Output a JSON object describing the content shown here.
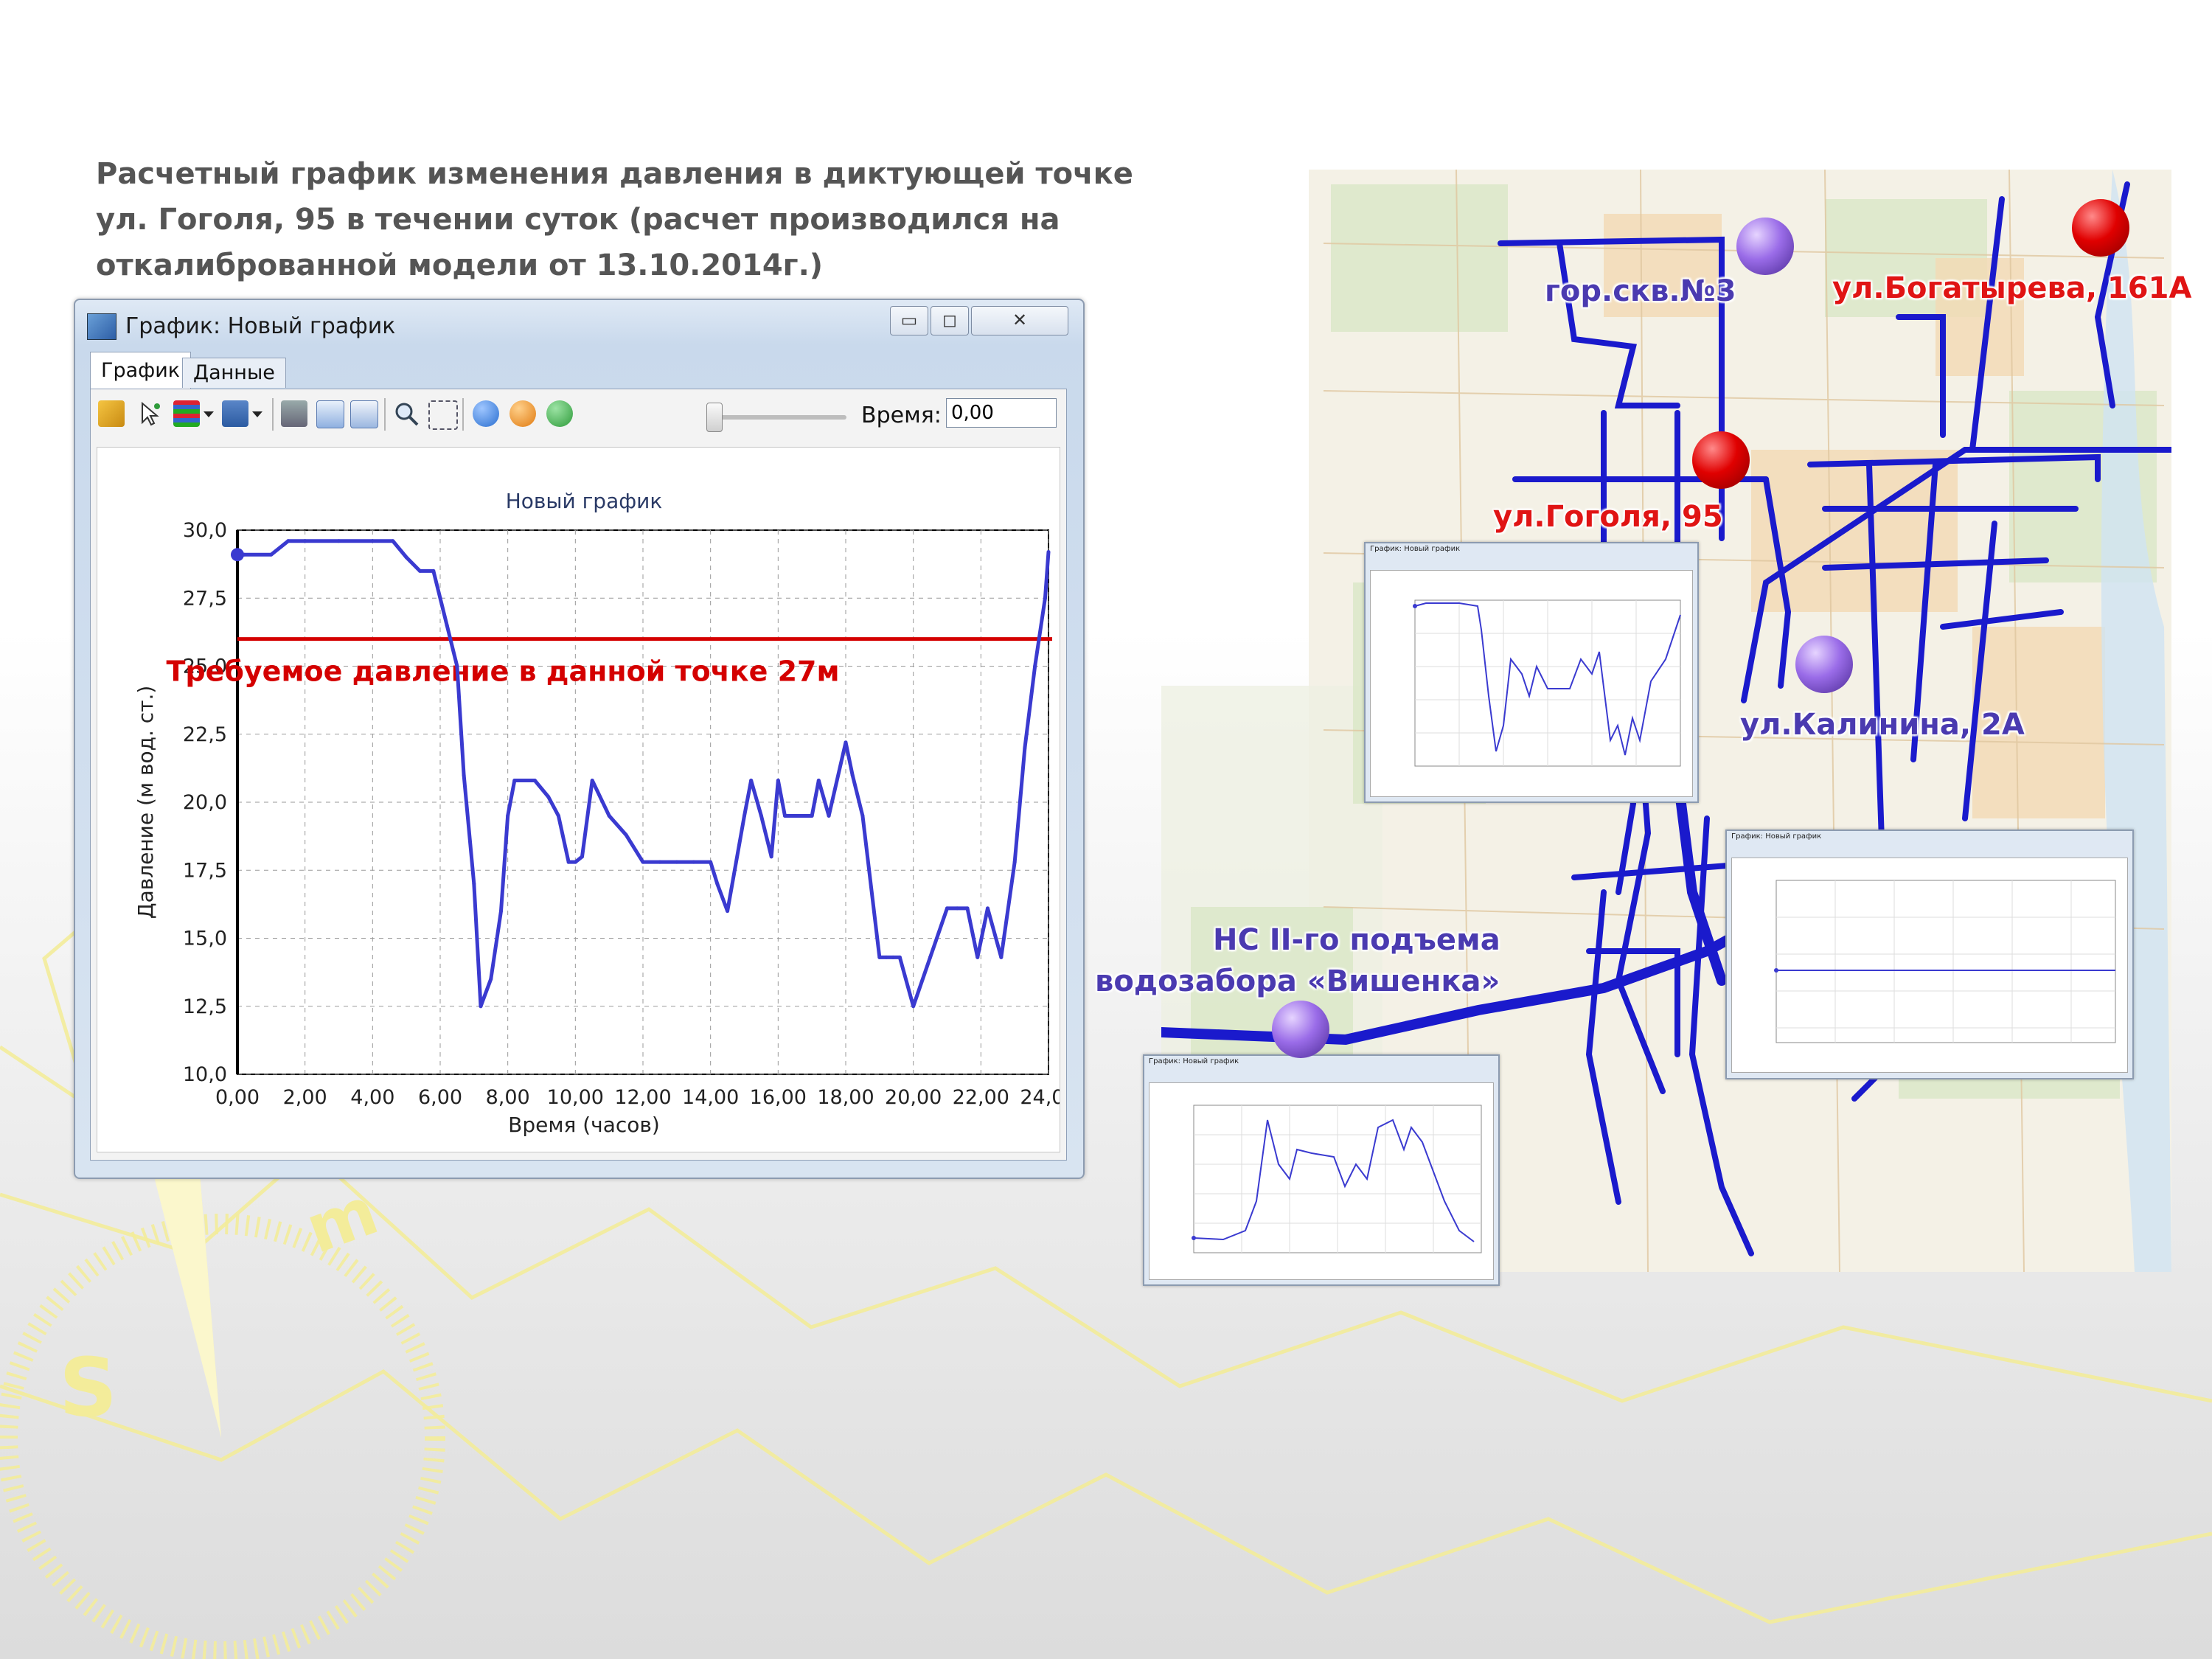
{
  "caption": "Расчетный график изменения давления в диктующей точке ул. Гоголя, 95 в течении суток (расчет производился на откалиброванной модели от 13.10.2014г.)",
  "window": {
    "title": "График: Новый график",
    "tabs": [
      "График",
      "Данные"
    ],
    "time_label": "Время:",
    "time_value": "0,00"
  },
  "icons": {
    "toolbar": [
      "open-folder-icon",
      "select-pointer-icon",
      "series-icon",
      "list-icon",
      "print-icon",
      "export-icon",
      "copy-icon",
      "zoom-icon",
      "zoom-area-icon",
      "rewind-icon",
      "pause-icon",
      "play-icon"
    ],
    "colors": {
      "play": "#2e9b3a",
      "pause": "#e07a10",
      "rewind": "#2a6fd0"
    }
  },
  "chart_data": [
    {
      "type": "line",
      "title": "Новый график",
      "xlabel": "Время (часов)",
      "ylabel": "Давление (м вод. ст.)",
      "xlim": [
        0,
        24
      ],
      "ylim": [
        10,
        30
      ],
      "xticks": [
        "0,00",
        "2,00",
        "4,00",
        "6,00",
        "8,00",
        "10,00",
        "12,00",
        "14,00",
        "16,00",
        "18,00",
        "20,00",
        "22,00",
        "24,00"
      ],
      "yticks": [
        "10,0",
        "12,5",
        "15,0",
        "17,5",
        "20,0",
        "22,5",
        "25,0",
        "27,5",
        "30,0"
      ],
      "grid": true,
      "series": [
        {
          "color": "#3a3ad0",
          "x": [
            0,
            0.2,
            1,
            1.5,
            2,
            3,
            4,
            4.6,
            5,
            5.4,
            5.8,
            6,
            6.2,
            6.5,
            6.7,
            7,
            7.2,
            7.5,
            7.8,
            8,
            8.2,
            8.4,
            8.8,
            9.2,
            9.5,
            9.8,
            10,
            10.2,
            10.5,
            11,
            11.5,
            12,
            12.5,
            13,
            13.5,
            14,
            14.2,
            14.5,
            15,
            15.2,
            15.5,
            15.8,
            16,
            16.2,
            16.5,
            17,
            17.2,
            17.5,
            18,
            18.2,
            18.5,
            19,
            19.2,
            19.4,
            19.6,
            20,
            20.5,
            21,
            21.3,
            21.6,
            21.9,
            22.2,
            22.6,
            23,
            23.3,
            23.6,
            23.9,
            24
          ],
          "y": [
            29.1,
            29.1,
            29.1,
            29.6,
            29.6,
            29.6,
            29.6,
            29.6,
            29.0,
            28.5,
            28.5,
            27.5,
            26.5,
            25.0,
            21.0,
            17.0,
            12.5,
            13.5,
            16.0,
            19.5,
            20.8,
            20.8,
            20.8,
            20.2,
            19.5,
            17.8,
            17.8,
            18.0,
            20.8,
            19.5,
            18.8,
            17.8,
            17.8,
            17.8,
            17.8,
            17.8,
            17.0,
            16.0,
            19.5,
            20.8,
            19.5,
            18.0,
            20.8,
            19.5,
            19.5,
            19.5,
            20.8,
            19.5,
            22.2,
            21.0,
            19.5,
            14.3,
            14.3,
            14.3,
            14.3,
            12.5,
            14.3,
            16.1,
            16.1,
            16.1,
            14.3,
            16.1,
            14.3,
            17.8,
            22.0,
            25.0,
            27.5,
            29.2
          ]
        }
      ],
      "annotations": [
        {
          "type": "hline",
          "y": 26.0,
          "color": "#d40000"
        },
        {
          "type": "text",
          "text": "Требуемое давление в данной точке 27м",
          "color": "#d40000"
        }
      ]
    }
  ],
  "map": {
    "labels": [
      {
        "text": "гор.скв.№3",
        "color": "#4a3ab0"
      },
      {
        "text": "ул.Богатырева, 161А",
        "color": "#e01414"
      },
      {
        "text": "ул.Гоголя, 95",
        "color": "#e01414"
      },
      {
        "text": "ул.Калинина, 2А",
        "color": "#4a3ab0"
      },
      {
        "text": "НС II-го подъема",
        "color": "#4a3ab0"
      },
      {
        "text": "водозабора «Вишенка»",
        "color": "#4a3ab0"
      }
    ],
    "network_color": "#1a1acc"
  }
}
